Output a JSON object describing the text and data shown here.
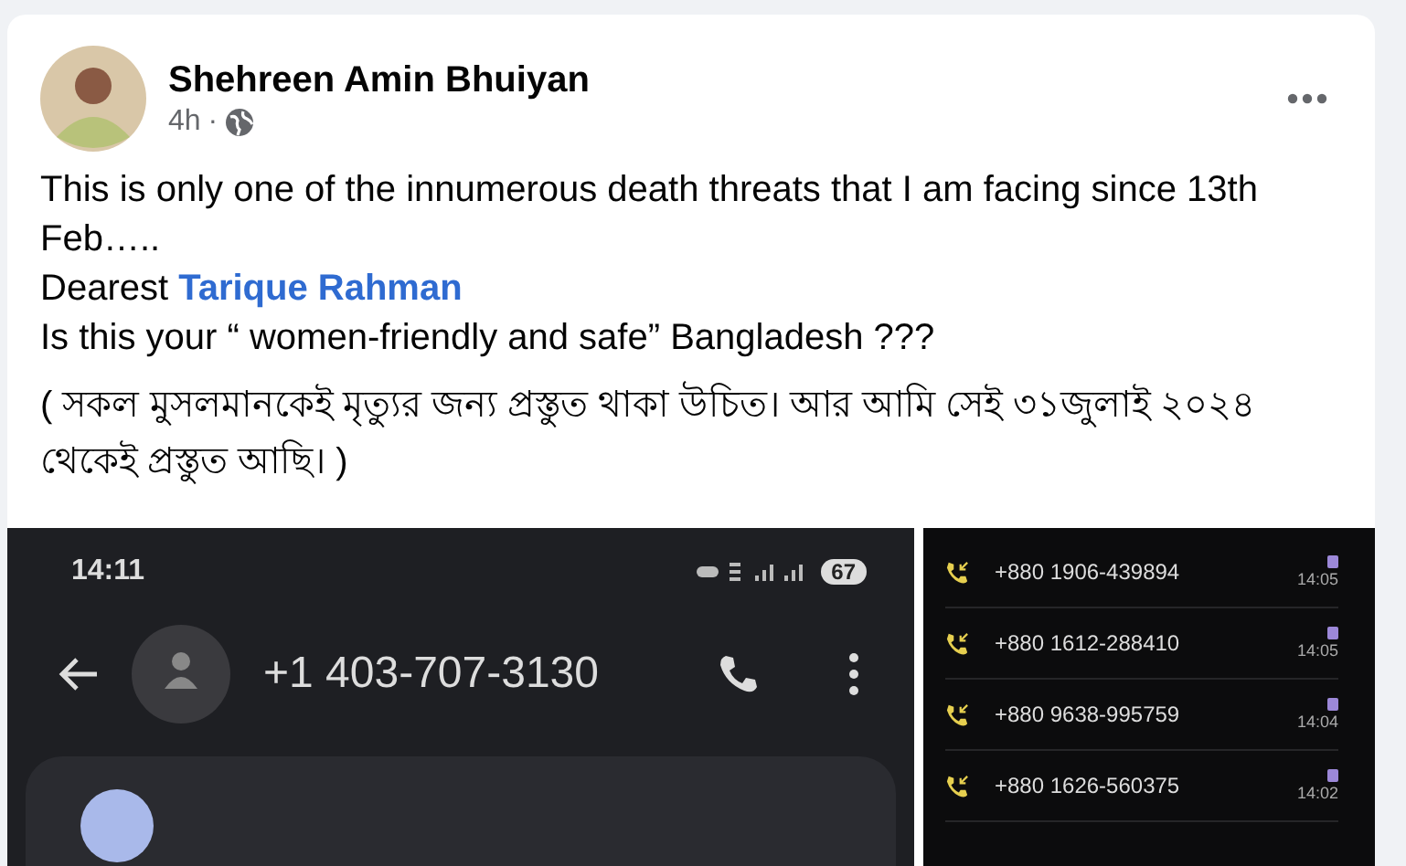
{
  "post": {
    "author": "Shehreen Amin Bhuiyan",
    "time": "4h",
    "separator": "·",
    "paragraphs": [
      {
        "kind": "plain",
        "text": "This is only one of the innumerous death threats that I am facing since 13th Feb….."
      },
      {
        "kind": "mention",
        "text": "Dearest ",
        "link": "Tarique Rahman"
      },
      {
        "kind": "plain",
        "text": "Is this your “ women-friendly and safe” Bangladesh ???"
      },
      {
        "kind": "plain",
        "text": "( সকল মুসলমানকেই মৃত্যুর জন্য প্রস্তুত থাকা উচিত। আর আমি সেই ৩১জুলাই ২০২৪ থেকেই প্রস্তুত আছি। )"
      }
    ]
  },
  "phone_screen": {
    "clock": "14:11",
    "battery": "67",
    "contact": "+1 403-707-3130"
  },
  "call_log": [
    {
      "number": "+880 1906-439894",
      "time": "14:05"
    },
    {
      "number": "+880 1612-288410",
      "time": "14:05"
    },
    {
      "number": "+880 9638-995759",
      "time": "14:04"
    },
    {
      "number": "+880 1626-560375",
      "time": "14:02"
    }
  ]
}
